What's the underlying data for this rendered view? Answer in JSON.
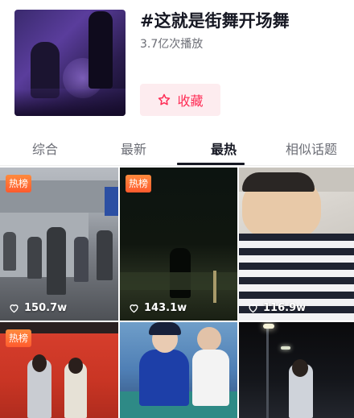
{
  "header": {
    "title": "#这就是街舞开场舞",
    "play_count": "3.7亿次播放",
    "collect_label": "收藏",
    "collect_icon": "star-outline-icon",
    "accent_color": "#fe2c55"
  },
  "tabs": [
    {
      "label": "综合",
      "active": false
    },
    {
      "label": "最新",
      "active": false
    },
    {
      "label": "最热",
      "active": true
    },
    {
      "label": "相似话题",
      "active": false
    }
  ],
  "videos": [
    {
      "badge": "热榜",
      "likes": "150.7w"
    },
    {
      "badge": "热榜",
      "likes": "143.1w"
    },
    {
      "badge": "",
      "likes": "116.9w"
    },
    {
      "badge": "热榜",
      "likes": ""
    },
    {
      "badge": "",
      "likes": ""
    },
    {
      "badge": "",
      "likes": ""
    }
  ]
}
